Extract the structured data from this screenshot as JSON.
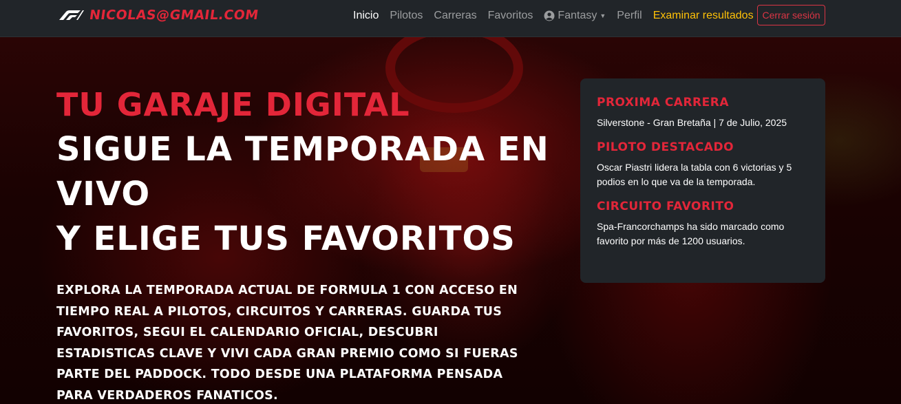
{
  "navbar": {
    "brand_email": "nicolas@gmail.com",
    "brand_logo": "f1-logo",
    "links": {
      "inicio": "Inicio",
      "pilotos": "Pilotos",
      "carreras": "Carreras",
      "favoritos": "Favoritos",
      "fantasy": "Fantasy",
      "perfil": "Perfil",
      "examinar": "Examinar resultados"
    },
    "fantasy_icon": "user-circle-icon",
    "logout_label": "Cerrar sesión"
  },
  "hero": {
    "title_red": "Tu garaje digital",
    "title_line_2": "Sigue la temporada en",
    "title_line_3": "vivo",
    "title_line_4": "y elige tus favoritos",
    "description": "Explora la temporada actual de Formula 1 con acceso en tiempo real a pilotos, circuitos y carreras. Guarda tus favoritos, segui el calendario oficial, descubri estadisticas clave y vivi cada gran premio como si fueras parte del paddock. Todo desde una plataforma pensada para verdaderos fanaticos."
  },
  "info_card": {
    "next_race_heading": "Proxima carrera",
    "next_race_text": "Silverstone - Gran Bretaña | 7 de Julio, 2025",
    "featured_driver_heading": "Piloto destacado",
    "featured_driver_text": "Oscar Piastri lidera la tabla con 6 victorias y 5 podios en lo que va de la temporada.",
    "favorite_circuit_heading": "Circuito favorito",
    "favorite_circuit_text": "Spa-Francorchamps ha sido marcado como favorito por más de 1200 usuarios."
  },
  "colors": {
    "accent_red": "#e32639",
    "navbar_bg": "#212529",
    "gold_link": "#ffc107",
    "danger": "#dc3545"
  }
}
